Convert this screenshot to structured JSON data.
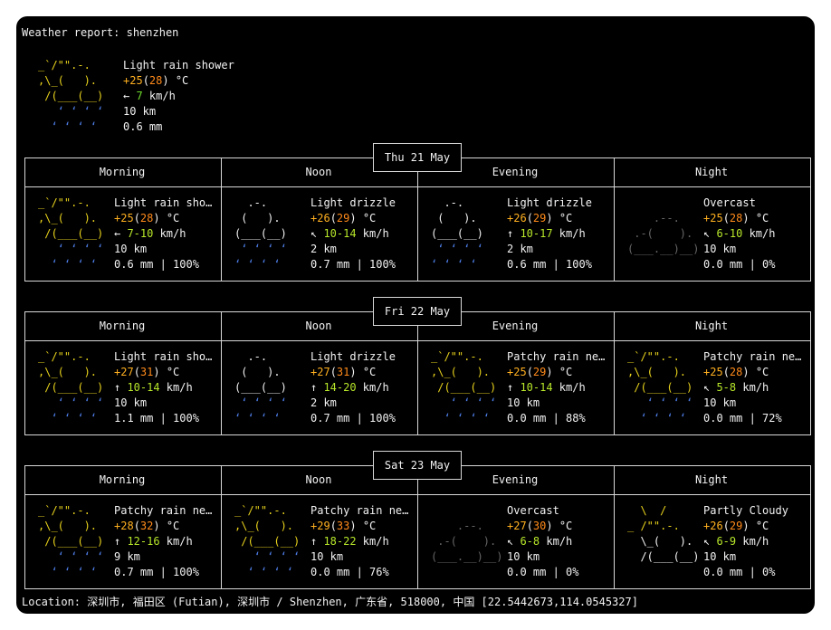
{
  "title": "Weather report: shenzhen",
  "current": {
    "condition": "Light rain shower",
    "temp": "+25",
    "feels": "28",
    "unit": " °C",
    "wind_arrow": "←",
    "wind": "7",
    "wind_unit": " km/h",
    "visibility": "10 km",
    "precip": "0.6 mm"
  },
  "periods": [
    "Morning",
    "Noon",
    "Evening",
    "Night"
  ],
  "art": {
    "rain_shower": [
      "_`/\"\".-.  ",
      ",\\_(   ).",
      " /(___(__)",
      "   ‘ ‘ ‘ ‘",
      "  ‘ ‘ ‘ ‘ "
    ],
    "drizzle": [
      "  .-.    ",
      " (   ).  ",
      "(___(__) ",
      " ‘ ‘ ‘ ‘ ",
      "‘ ‘ ‘ ‘  "
    ],
    "overcast": [
      "    .--.   ",
      " .-(    ).",
      "(___.__)__)"
    ],
    "partly": [
      "  \\  /     ",
      "_ /\"\".-.   ",
      "  \\_(   ). ",
      "  /(___(__)"
    ]
  },
  "days": [
    {
      "date": "Thu 21 May",
      "slots": [
        {
          "icon": "rain_shower",
          "cond": "Light rain sho…",
          "temp": "+25",
          "feels": "28",
          "arrow": "←",
          "wind": "7-10",
          "vis": "10 km",
          "precip": "0.6 mm | 100%"
        },
        {
          "icon": "drizzle",
          "cond": "Light drizzle",
          "temp": "+26",
          "feels": "29",
          "arrow": "↖",
          "wind": "10-14",
          "vis": "2 km",
          "precip": "0.7 mm | 100%"
        },
        {
          "icon": "drizzle",
          "cond": "Light drizzle",
          "temp": "+26",
          "feels": "29",
          "arrow": "↑",
          "wind": "10-17",
          "vis": "2 km",
          "precip": "0.6 mm | 100%"
        },
        {
          "icon": "overcast",
          "cond": "Overcast",
          "temp": "+25",
          "feels": "28",
          "arrow": "↖",
          "wind": "6-10",
          "vis": "10 km",
          "precip": "0.0 mm | 0%"
        }
      ]
    },
    {
      "date": "Fri 22 May",
      "slots": [
        {
          "icon": "rain_shower",
          "cond": "Light rain sho…",
          "temp": "+27",
          "feels": "31",
          "arrow": "↑",
          "wind": "10-14",
          "vis": "10 km",
          "precip": "1.1 mm | 100%"
        },
        {
          "icon": "drizzle",
          "cond": "Light drizzle",
          "temp": "+27",
          "feels": "31",
          "arrow": "↑",
          "wind": "14-20",
          "vis": "2 km",
          "precip": "0.7 mm | 100%"
        },
        {
          "icon": "rain_shower",
          "cond": "Patchy rain ne…",
          "temp": "+25",
          "feels": "29",
          "arrow": "↑",
          "wind": "10-14",
          "vis": "10 km",
          "precip": "0.0 mm | 88%"
        },
        {
          "icon": "rain_shower",
          "cond": "Patchy rain ne…",
          "temp": "+25",
          "feels": "28",
          "arrow": "↖",
          "wind": "5-8",
          "vis": "10 km",
          "precip": "0.0 mm | 72%"
        }
      ]
    },
    {
      "date": "Sat 23 May",
      "slots": [
        {
          "icon": "rain_shower",
          "cond": "Patchy rain ne…",
          "temp": "+28",
          "feels": "32",
          "arrow": "↑",
          "wind": "12-16",
          "vis": "9 km",
          "precip": "0.7 mm | 100%"
        },
        {
          "icon": "rain_shower",
          "cond": "Patchy rain ne…",
          "temp": "+29",
          "feels": "33",
          "arrow": "↑",
          "wind": "18-22",
          "vis": "10 km",
          "precip": "0.0 mm | 76%"
        },
        {
          "icon": "overcast",
          "cond": "Overcast",
          "temp": "+27",
          "feels": "30",
          "arrow": "↖",
          "wind": "6-8",
          "vis": "10 km",
          "precip": "0.0 mm | 0%"
        },
        {
          "icon": "partly",
          "cond": "Partly Cloudy",
          "temp": "+26",
          "feels": "29",
          "arrow": "↖",
          "wind": "6-9",
          "vis": "10 km",
          "precip": "0.0 mm | 0%"
        }
      ]
    }
  ],
  "temp_unit": " °C",
  "wind_unit": " km/h",
  "location": "Location: 深圳市, 福田区 (Futian), 深圳市 / Shenzhen, 广东省, 518000, 中国 [22.5442673,114.0545327]",
  "colors": {
    "background": "#000000",
    "text": "#f2f2f2",
    "sun": "#e8d21c",
    "rain": "#4e7ee8",
    "cloud_gray": "#666666",
    "feels": "#ff8a1a",
    "wind": "#6fdc2c"
  }
}
